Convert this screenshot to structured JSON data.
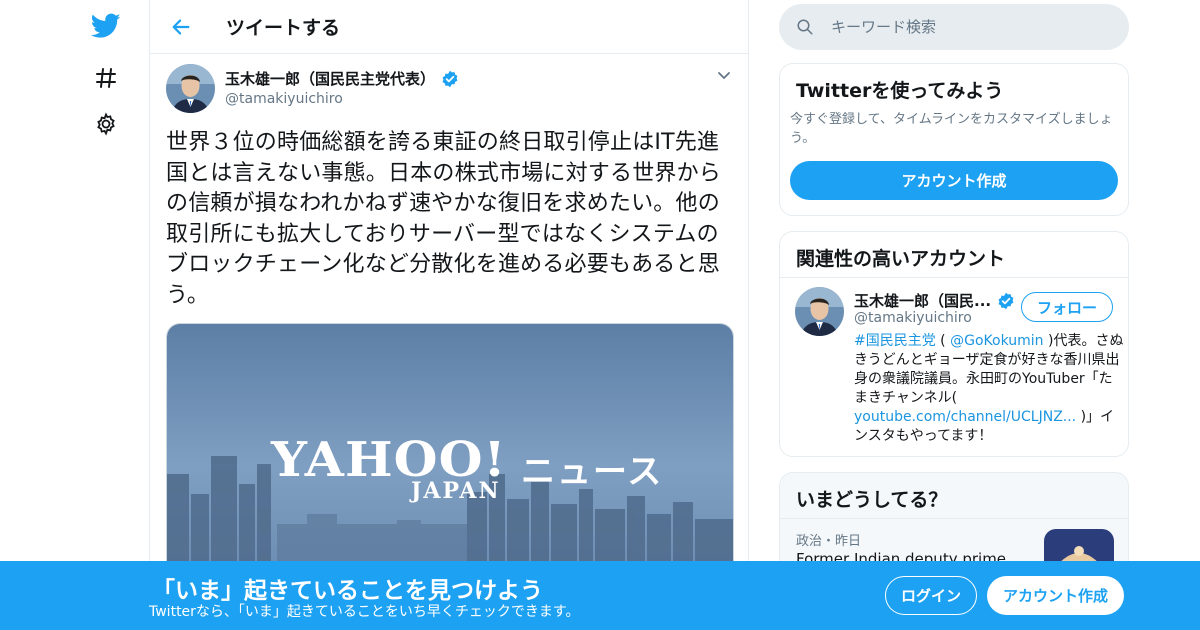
{
  "colors": {
    "brand": "#1da1f2",
    "text": "#14171a",
    "secondary": "#657786",
    "border": "#e6ecf0"
  },
  "nav": {
    "items": [
      {
        "icon": "twitter-bird-icon"
      },
      {
        "icon": "hashtag-icon"
      },
      {
        "icon": "gear-icon"
      }
    ]
  },
  "header": {
    "title": "ツイートする"
  },
  "tweet": {
    "author_name": "玉木雄一郎（国民民主党代表）",
    "author_handle": "@tamakiyuichiro",
    "verified": true,
    "text": "世界３位の時価総額を誇る東証の終日取引停止はIT先進国とは言えない事態。日本の株式市場に対する世界からの信頼が損なわれかねず速やかな復旧を求めたい。他の取引所にも拡大しておりサーバー型ではなくシステムのブロックチェーン化など分散化を進める必要もあると思う。",
    "media": {
      "yahoo": "YAHOO!",
      "japan": "JAPAN",
      "news": "ニュース"
    }
  },
  "search": {
    "placeholder": "キーワード検索"
  },
  "signup_card": {
    "title": "Twitterを使ってみよう",
    "description": "今すぐ登録して、タイムラインをカスタマイズしましょう。",
    "button": "アカウント作成"
  },
  "related_card": {
    "title": "関連性の高いアカウント",
    "account": {
      "name": "玉木雄一郎（国民...",
      "handle": "@tamakiyuichiro",
      "follow_label": "フォロー",
      "bio_hashtag": "#国民民主党",
      "bio_open": " ( ",
      "bio_mention": "@GoKokumin",
      "bio_mid": " )代表。さぬきうどんとギョーザ定食が好きな香川県出身の衆議院議員。永田町のYouTuber「たまきチャンネル( ",
      "bio_link": "youtube.com/channel/UCLJNZ...",
      "bio_end": " )」インスタもやってます！"
    }
  },
  "trends_card": {
    "title": "いまどうしてる？",
    "item": {
      "meta": "政治・昨日",
      "headline": "Former Indian deputy prime"
    }
  },
  "banner": {
    "title": "「いま」起きていることを見つけよう",
    "subtitle": "Twitterなら、「いま」起きていることをいち早くチェックできます。",
    "login": "ログイン",
    "signup": "アカウント作成"
  }
}
